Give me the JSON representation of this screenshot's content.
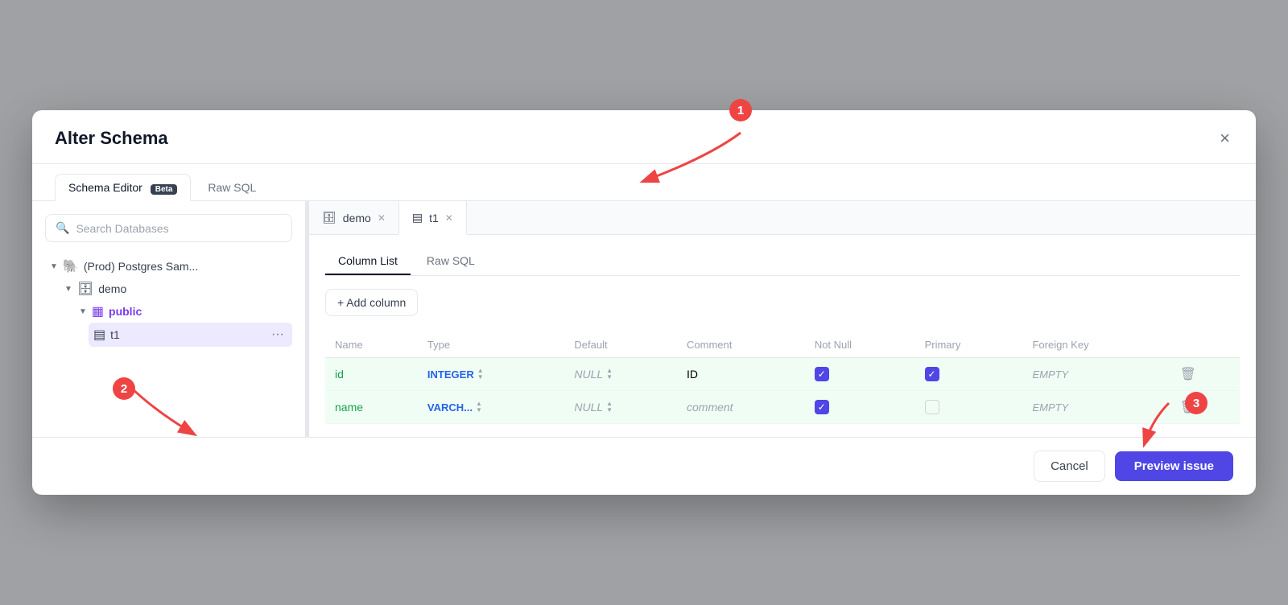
{
  "modal": {
    "title": "Alter Schema",
    "close_label": "×"
  },
  "tabs": {
    "schema_editor": "Schema Editor",
    "schema_editor_badge": "Beta",
    "raw_sql": "Raw SQL"
  },
  "sidebar": {
    "search_placeholder": "Search Databases",
    "tree": [
      {
        "level": 1,
        "icon": "🐘",
        "label": "(Prod) Postgres Sam...",
        "expanded": true,
        "type": "db"
      },
      {
        "level": 2,
        "icon": "🗄",
        "label": "demo",
        "expanded": true,
        "type": "schema"
      },
      {
        "level": 3,
        "icon": "▦",
        "label": "public",
        "expanded": true,
        "type": "group",
        "color": "#7c3aed"
      },
      {
        "level": 4,
        "icon": "▤",
        "label": "t1",
        "expanded": false,
        "type": "table",
        "active": true
      }
    ]
  },
  "db_tabs": [
    {
      "icon": "🗄",
      "label": "demo",
      "active": false
    },
    {
      "icon": "▤",
      "label": "t1",
      "active": true
    }
  ],
  "sub_tabs": [
    {
      "label": "Column List",
      "active": true
    },
    {
      "label": "Raw SQL",
      "active": false
    }
  ],
  "add_column_label": "+ Add column",
  "table_headers": [
    "Name",
    "Type",
    "Default",
    "Comment",
    "Not Null",
    "Primary",
    "Foreign Key",
    ""
  ],
  "table_rows": [
    {
      "name": "id",
      "type": "INTEGER",
      "default": "NULL",
      "comment": "ID",
      "not_null": true,
      "primary": true,
      "foreign_key": "EMPTY"
    },
    {
      "name": "name",
      "type": "VARCH...",
      "default": "NULL",
      "comment": "comment",
      "not_null": true,
      "primary": false,
      "foreign_key": "EMPTY"
    }
  ],
  "footer": {
    "cancel_label": "Cancel",
    "preview_label": "Preview issue"
  },
  "annotations": {
    "badge_1": "1",
    "badge_2": "2",
    "badge_3": "3"
  }
}
